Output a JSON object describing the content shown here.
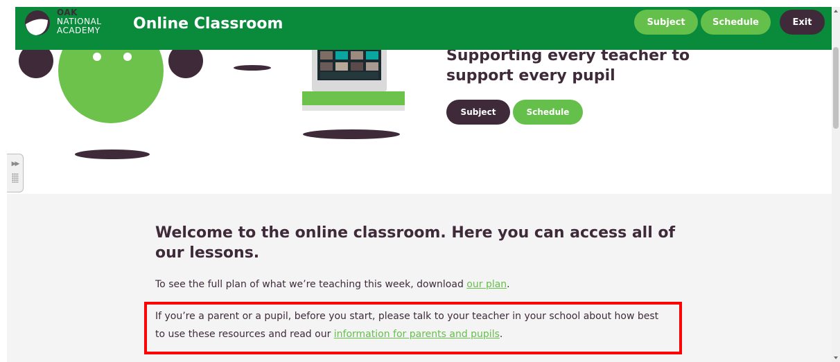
{
  "header": {
    "logo": {
      "line1": "OAK",
      "line2": "NATIONAL",
      "line3": "ACADEMY"
    },
    "title": "Online Classroom",
    "buttons": {
      "subject": "Subject",
      "schedule": "Schedule",
      "exit": "Exit"
    }
  },
  "hero": {
    "title": "Supporting every teacher to support every pupil",
    "buttons": {
      "subject": "Subject",
      "schedule": "Schedule"
    }
  },
  "content": {
    "welcome": "Welcome to the online classroom. Here you can access all of our lessons.",
    "para1": {
      "text": "To see the full plan of what we’re teaching this week, download ",
      "link": "our plan",
      "after": "."
    },
    "para2": {
      "text": "If you’re a parent or a pupil, before you start, please talk to your teacher in your school about how best to use these resources and read our ",
      "link": "information for parents and pupils",
      "after": "."
    }
  },
  "colors": {
    "header_green": "#0a8a3b",
    "accent_green": "#64c04a",
    "dark_purple": "#3f2a3a",
    "highlight_red": "#ff0000",
    "content_bg": "#f4f4f4"
  },
  "icons": [
    "oak-logo-icon",
    "expand-arrows-icon",
    "drag-grip-icon",
    "scroll-up-icon",
    "scroll-down-icon"
  ]
}
